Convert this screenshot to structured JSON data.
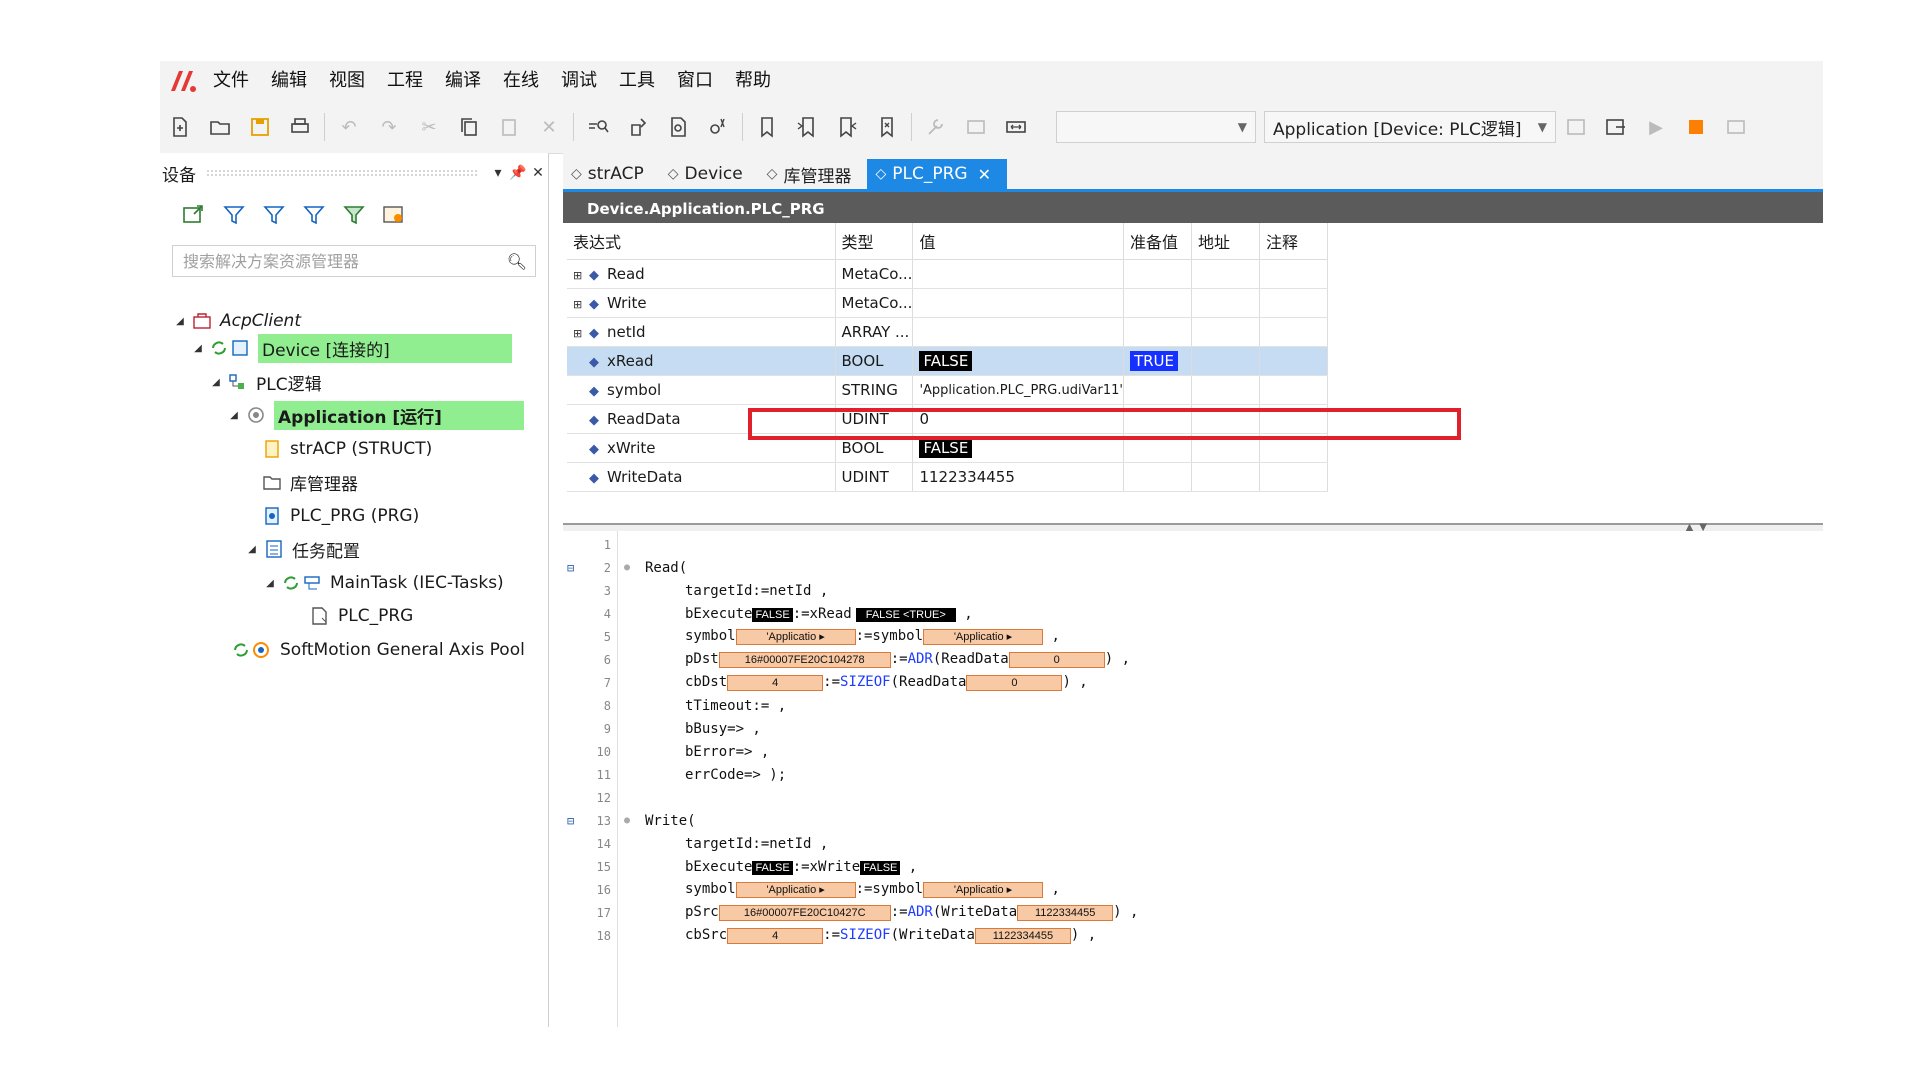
{
  "menu": [
    "文件",
    "编辑",
    "视图",
    "工程",
    "编译",
    "在线",
    "调试",
    "工具",
    "窗口",
    "帮助"
  ],
  "toolbar": {
    "combo_empty": "",
    "combo_app": "Application [Device: PLC逻辑]"
  },
  "device_pane": {
    "title": "设备",
    "search_placeholder": "搜索解决方案资源管理器",
    "tree": [
      {
        "label": "AcpClient"
      },
      {
        "label": "Device [连接的]"
      },
      {
        "label": "PLC逻辑"
      },
      {
        "label": "Application [运行]"
      },
      {
        "label": "strACP (STRUCT)"
      },
      {
        "label": "库管理器"
      },
      {
        "label": "PLC_PRG (PRG)"
      },
      {
        "label": "任务配置"
      },
      {
        "label": "MainTask (IEC-Tasks)"
      },
      {
        "label": "PLC_PRG"
      },
      {
        "label": "SoftMotion General Axis Pool"
      }
    ]
  },
  "tabs": [
    {
      "label": "strACP"
    },
    {
      "label": "Device"
    },
    {
      "label": "库管理器"
    },
    {
      "label": "PLC_PRG"
    }
  ],
  "panel_title": "Device.Application.PLC_PRG",
  "watch": {
    "headers": [
      "表达式",
      "类型",
      "值",
      "准备值",
      "地址",
      "注释"
    ],
    "rows": [
      {
        "expr": "Read",
        "type": "MetaCo...",
        "value": "",
        "prepared": ""
      },
      {
        "expr": "Write",
        "type": "MetaCo...",
        "value": "",
        "prepared": ""
      },
      {
        "expr": "netId",
        "type": "ARRAY ...",
        "value": "",
        "prepared": ""
      },
      {
        "expr": "xRead",
        "type": "BOOL",
        "value": "FALSE",
        "prepared": "TRUE"
      },
      {
        "expr": "symbol",
        "type": "STRING",
        "value": "'Application.PLC_PRG.udiVar11'",
        "prepared": ""
      },
      {
        "expr": "ReadData",
        "type": "UDINT",
        "value": "0",
        "prepared": ""
      },
      {
        "expr": "xWrite",
        "type": "BOOL",
        "value": "FALSE",
        "prepared": ""
      },
      {
        "expr": "WriteData",
        "type": "UDINT",
        "value": "1122334455",
        "prepared": ""
      }
    ]
  },
  "code": {
    "line_numbers": [
      "1",
      "2",
      "3",
      "4",
      "5",
      "6",
      "7",
      "8",
      "9",
      "10",
      "11",
      "12",
      "13",
      "14",
      "15",
      "16",
      "17",
      "18"
    ],
    "l2": "Read(",
    "l3": "targetId:=netId ,",
    "l4a": "bExecute",
    "l4_v1": "FALSE",
    "l4b": ":=xRead",
    "l4_v2": "FALSE <TRUE>",
    "l4c": " ,",
    "l5a": "symbol",
    "l5_v1": "'Applicatio",
    "l5b": ":=symbol",
    "l5_v2": "'Applicatio",
    "l5c": " ,",
    "l6a": "pDst",
    "l6_v1": "16#00007FE20C104278",
    "l6b": ":=",
    "l6_kw": "ADR",
    "l6c": "(ReadData",
    "l6_v2": "0",
    "l6d": ") ,",
    "l7a": "cbDst",
    "l7_v1": "4",
    "l7b": ":=",
    "l7_kw": "SIZEOF",
    "l7c": "(ReadData",
    "l7_v2": "0",
    "l7d": ") ,",
    "l8": "tTimeout:= ,",
    "l9": "bBusy=> ,",
    "l10": "bError=> ,",
    "l11": "errCode=> );",
    "l13": "Write(",
    "l14": "targetId:=netId ,",
    "l15a": "bExecute",
    "l15_v1": "FALSE",
    "l15b": ":=xWrite",
    "l15_v2": "FALSE",
    "l15c": " ,",
    "l16a": "symbol",
    "l16_v1": "'Applicatio",
    "l16b": ":=symbol",
    "l16_v2": "'Applicatio",
    "l16c": " ,",
    "l17a": "pSrc",
    "l17_v1": "16#00007FE20C10427C",
    "l17b": ":=",
    "l17_kw": "ADR",
    "l17c": "(WriteData",
    "l17_v2": "1122334455",
    "l17d": ") ,",
    "l18a": "cbSrc",
    "l18_v1": "4",
    "l18b": ":=",
    "l18_kw": "SIZEOF",
    "l18c": "(WriteData",
    "l18_v2": "1122334455",
    "l18d": ") ,"
  },
  "colors": {
    "accent": "#1e88e5",
    "highlight": "#90ee90",
    "selection": "#c6dcf2",
    "error_frame": "#e0202a",
    "prepared": "#1530ff"
  }
}
